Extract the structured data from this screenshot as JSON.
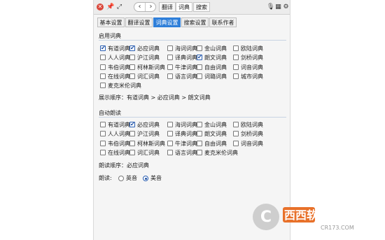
{
  "topbar": {
    "nav_tabs": [
      "翻译",
      "词典",
      "搜索"
    ]
  },
  "tabs": [
    "基本设置",
    "翻译设置",
    "词典设置",
    "搜索设置",
    "联系作者"
  ],
  "enabled_section": {
    "title": "启用词典",
    "items": [
      {
        "label": "有道词典",
        "checked": true
      },
      {
        "label": "必应词典",
        "checked": true
      },
      {
        "label": "海词词典",
        "checked": false
      },
      {
        "label": "金山词典",
        "checked": false
      },
      {
        "label": "欧陆词典",
        "checked": false
      },
      {
        "label": "人人词典",
        "checked": false
      },
      {
        "label": "沪江词典",
        "checked": false
      },
      {
        "label": "译典词典",
        "checked": false
      },
      {
        "label": "朗文词典",
        "checked": true
      },
      {
        "label": "剑桥词典",
        "checked": false
      },
      {
        "label": "韦伯词典",
        "checked": false
      },
      {
        "label": "柯林斯词典",
        "checked": false
      },
      {
        "label": "牛津词典",
        "checked": false
      },
      {
        "label": "自由词典",
        "checked": false
      },
      {
        "label": "词音词典",
        "checked": false
      },
      {
        "label": "在线词典",
        "checked": false
      },
      {
        "label": "词汇词典",
        "checked": false
      },
      {
        "label": "语言词典",
        "checked": false
      },
      {
        "label": "词璐词典",
        "checked": false
      },
      {
        "label": "城市词典",
        "checked": false
      },
      {
        "label": "麦克米伦词典",
        "checked": false
      }
    ],
    "order_text": "展示顺序：有道词典 > 必应词典 > 朗文词典"
  },
  "autoread_section": {
    "title": "自动朗读",
    "items": [
      {
        "label": "有道词典",
        "checked": false
      },
      {
        "label": "必应词典",
        "checked": true
      },
      {
        "label": "海词词典",
        "checked": false
      },
      {
        "label": "金山词典",
        "checked": false
      },
      {
        "label": "欧陆词典",
        "checked": false
      },
      {
        "label": "人人词典",
        "checked": false
      },
      {
        "label": "沪江词典",
        "checked": false
      },
      {
        "label": "译典词典",
        "checked": false
      },
      {
        "label": "朗文词典",
        "checked": false
      },
      {
        "label": "剑桥词典",
        "checked": false
      },
      {
        "label": "韦伯词典",
        "checked": false
      },
      {
        "label": "柯林斯词典",
        "checked": false
      },
      {
        "label": "牛津词典",
        "checked": false
      },
      {
        "label": "自由词典",
        "checked": false
      },
      {
        "label": "词音词典",
        "checked": false
      },
      {
        "label": "在线词典",
        "checked": false
      },
      {
        "label": "词汇词典",
        "checked": false
      },
      {
        "label": "语言词典",
        "checked": false
      },
      {
        "label": "麦克米伦词典",
        "checked": false
      }
    ],
    "order_text": "朗读顺序：必应词典",
    "accent_label": "朗读:",
    "accent_options": [
      {
        "label": "英音",
        "checked": false
      },
      {
        "label": "美音",
        "checked": true
      }
    ]
  },
  "watermark": {
    "brand_text": "西西软件园",
    "url_text": "CR173.COM"
  },
  "colors": {
    "accent": "#2f7fd9",
    "close": "#d9473b"
  }
}
